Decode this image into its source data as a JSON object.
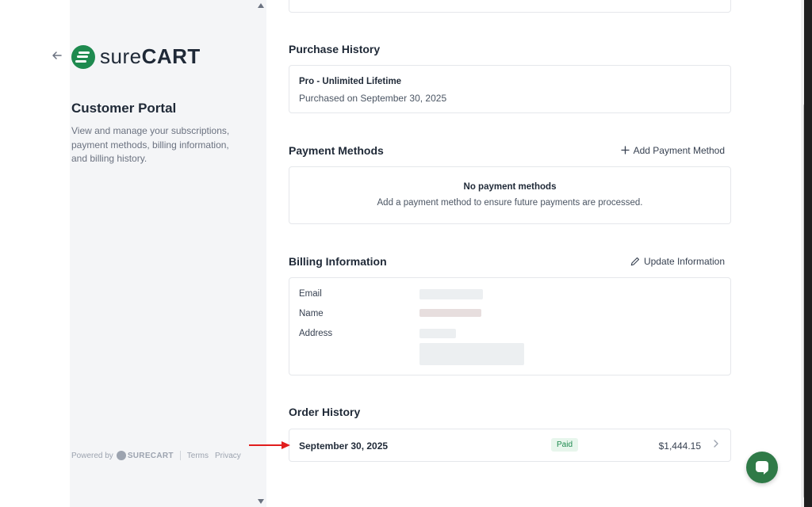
{
  "brand": {
    "logo_text_light": "sure",
    "logo_text_bold": "CART",
    "accent": "#1e8a4f"
  },
  "sidebar": {
    "back_icon": "arrow-left-icon",
    "title": "Customer Portal",
    "description": "View and manage your subscriptions, payment methods, billing information, and billing history.",
    "footer": {
      "powered_by": "Powered by",
      "brand": "SURECART",
      "terms": "Terms",
      "privacy": "Privacy"
    }
  },
  "purchase_history": {
    "title": "Purchase History",
    "item_title": "Pro - Unlimited Lifetime",
    "item_subtitle": "Purchased on September 30, 2025"
  },
  "payment_methods": {
    "title": "Payment Methods",
    "action_label": "Add Payment Method",
    "empty_title": "No payment methods",
    "empty_subtitle": "Add a payment method to ensure future payments are processed."
  },
  "billing_information": {
    "title": "Billing Information",
    "action_label": "Update Information",
    "labels": {
      "email": "Email",
      "name": "Name",
      "address": "Address"
    }
  },
  "order_history": {
    "title": "Order History",
    "orders": [
      {
        "date": "September 30, 2025",
        "status": "Paid",
        "amount": "$1,444.15"
      }
    ]
  },
  "status_colors": {
    "paid_bg": "#e7f6ec",
    "paid_text": "#1e8a4f"
  }
}
